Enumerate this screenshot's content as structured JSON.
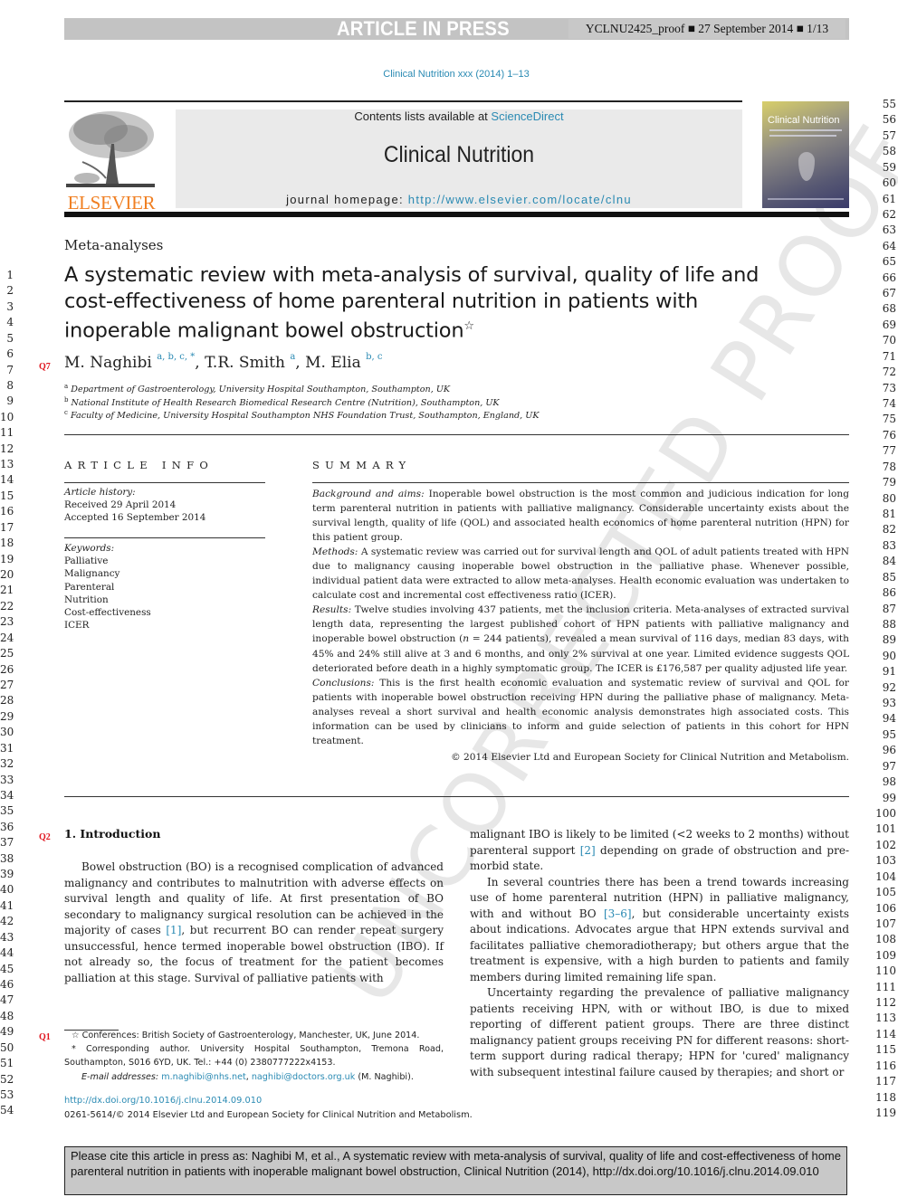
{
  "banner": {
    "title": "ARTICLE IN PRESS",
    "meta": "YCLNU2425_proof ■ 27 September 2014 ■ 1/13"
  },
  "journal_ref": "Clinical Nutrition xxx (2014) 1–13",
  "header": {
    "publisher": "ELSEVIER",
    "contents_prefix": "Contents lists available at ",
    "contents_link": "ScienceDirect",
    "journal_name": "Clinical Nutrition",
    "homepage_prefix": "journal homepage: ",
    "homepage_link": "http://www.elsevier.com/locate/clnu",
    "cover_title": "Clinical Nutrition"
  },
  "article": {
    "section": "Meta-analyses",
    "title_lines": [
      "A systematic review with meta-analysis of survival, quality of life and",
      "cost-effectiveness of home parenteral nutrition in patients with",
      "inoperable malignant bowel obstruction"
    ],
    "title_mark": "☆",
    "authors": [
      {
        "name": "M. Naghibi",
        "sup": "a, b, c, *",
        "sep": ", "
      },
      {
        "name": "T.R. Smith",
        "sup": "a",
        "sep": ", "
      },
      {
        "name": "M. Elia",
        "sup": "b, c",
        "sep": ""
      }
    ],
    "affiliations": [
      {
        "sup": "a",
        "text": "Department of Gastroenterology, University Hospital Southampton, Southampton, UK"
      },
      {
        "sup": "b",
        "text": "National Institute of Health Research Biomedical Research Centre (Nutrition), Southampton, UK"
      },
      {
        "sup": "c",
        "text": "Faculty of Medicine, University Hospital Southampton NHS Foundation Trust, Southampton, England, UK"
      }
    ]
  },
  "article_info": {
    "heading": "ARTICLE INFO",
    "history_label": "Article history:",
    "received": "Received 29 April 2014",
    "accepted": "Accepted 16 September 2014",
    "keywords_label": "Keywords:",
    "keywords": [
      "Palliative",
      "Malignancy",
      "Parenteral",
      "Nutrition",
      "Cost-effectiveness",
      "ICER"
    ]
  },
  "summary": {
    "heading": "SUMMARY",
    "background_label": "Background and aims:",
    "background": "Inoperable bowel obstruction is the most common and judicious indication for long term parenteral nutrition in patients with palliative malignancy. Considerable uncertainty exists about the survival length, quality of life (QOL) and associated health economics of home parenteral nutrition (HPN) for this patient group.",
    "methods_label": "Methods:",
    "methods": "A systematic review was carried out for survival length and QOL of adult patients treated with HPN due to malignancy causing inoperable bowel obstruction in the palliative phase. Whenever possible, individual patient data were extracted to allow meta-analyses. Health economic evaluation was undertaken to calculate cost and incremental cost effectiveness ratio (ICER).",
    "results_label": "Results:",
    "results_a": "Twelve studies involving 437 patients, met the inclusion criteria. Meta-analyses of extracted survival length data, representing the largest published cohort of HPN patients with palliative malignancy and inoperable bowel obstruction (",
    "results_n": "n",
    "results_b": " = 244 patients), revealed a mean survival of 116 days, median 83 days, with 45% and 24% still alive at 3 and 6 months, and only 2% survival at one year. Limited evidence suggests QOL deteriorated before death in a highly symptomatic group. The ICER is £176,587 per quality adjusted life year.",
    "conclusions_label": "Conclusions:",
    "conclusions": "This is the first health economic evaluation and systematic review of survival and QOL for patients with inoperable bowel obstruction receiving HPN during the palliative phase of malignancy. Meta-analyses reveal a short survival and health economic analysis demonstrates high associated costs. This information can be used by clinicians to inform and guide selection of patients in this cohort for HPN treatment.",
    "copyright": "© 2014 Elsevier Ltd and European Society for Clinical Nutrition and Metabolism."
  },
  "introduction": {
    "heading": "1.  Introduction",
    "p1_a": "Bowel obstruction (BO) is a recognised complication of advanced malignancy and contributes to malnutrition with adverse effects on survival length and quality of life. At first presentation of BO secondary to malignancy surgical resolution can be achieved in the majority of cases ",
    "p1_ref": "[1]",
    "p1_b": ", but recurrent BO can render repeat surgery unsuccessful, hence termed inoperable bowel obstruction (IBO). If not already so, the focus of treatment for the patient becomes palliation at this stage. Survival of palliative patients with",
    "p1_cont_a": "malignant IBO is likely to be limited (<2 weeks to 2 months) without parenteral support ",
    "p1_cont_ref": "[2]",
    "p1_cont_b": " depending on grade of obstruction and pre-morbid state.",
    "p2_a": "In several countries there has been a trend towards increasing use of home parenteral nutrition (HPN) in palliative malignancy, with and without BO ",
    "p2_ref": "[3–6]",
    "p2_b": ", but considerable uncertainty exists about indications. Advocates argue that HPN extends survival and facilitates palliative chemoradiotherapy; but others argue that the treatment is expensive, with a high burden to patients and family members during limited remaining life span.",
    "p3": "Uncertainty regarding the prevalence of palliative malignancy patients receiving HPN, with or without IBO, is due to mixed reporting of different patient groups. There are three distinct malignancy patient groups receiving PN for different reasons: short-term support during radical therapy; HPN for 'cured' malignancy with subsequent intestinal failure caused by therapies; and short or"
  },
  "footnotes": {
    "conference": "☆  Conferences: British Society of Gastroenterology, Manchester, UK, June 2014.",
    "corresponding": "* Corresponding author. University Hospital Southampton, Tremona Road, Southampton, S016 6YD, UK. Tel.: +44 (0) 2380777222x4153.",
    "email_label": "E-mail addresses:",
    "email1": "m.naghibi@nhs.net",
    "email_sep": ", ",
    "email2": "naghibi@doctors.org.uk",
    "email_owner": " (M. Naghibi)."
  },
  "doi": "http://dx.doi.org/10.1016/j.clnu.2014.09.010",
  "issn": "0261-5614/© 2014 Elsevier Ltd and European Society for Clinical Nutrition and Metabolism.",
  "query_marks": {
    "q7": "Q7",
    "q2": "Q2",
    "q1": "Q1"
  },
  "line_numbers": {
    "left_start": 1,
    "left_end": 54,
    "right_start": 55,
    "right_end": 119
  },
  "watermark": "UNCORRECTED PROOF",
  "cite_box": "Please cite this article in press as: Naghibi M, et al., A systematic review with meta-analysis of survival, quality of life and cost-effectiveness of home parenteral nutrition in patients with inoperable malignant bowel obstruction, Clinical Nutrition (2014), http://dx.doi.org/10.1016/j.clnu.2014.09.010"
}
